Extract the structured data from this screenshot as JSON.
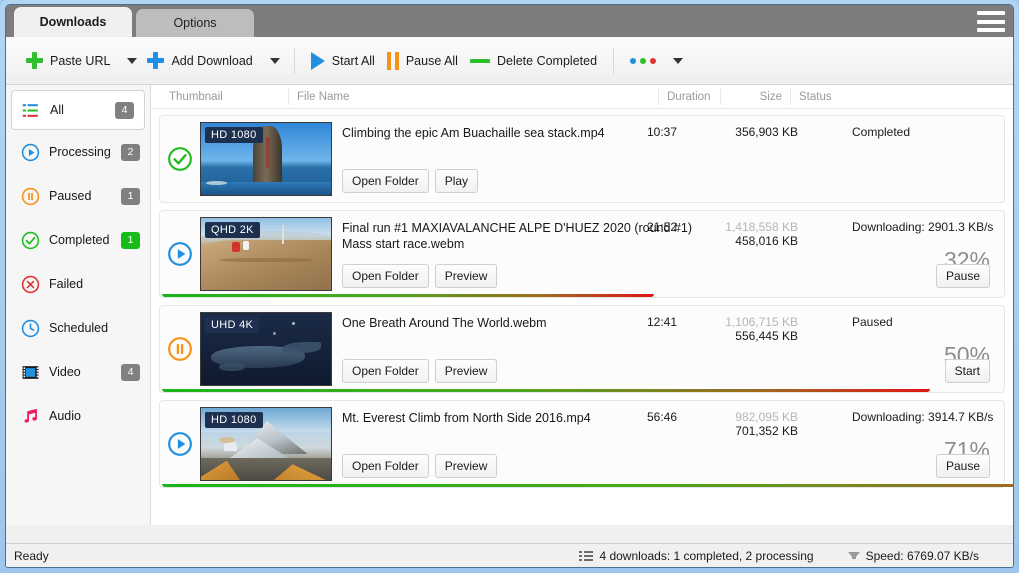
{
  "window": {
    "title": "Downloads"
  },
  "tabs": [
    {
      "label": "Downloads",
      "active": true
    },
    {
      "label": "Options",
      "active": false
    }
  ],
  "menu": {
    "hamburger_icon": "hamburger-icon"
  },
  "toolbar": {
    "paste_url": "Paste URL",
    "add_download": "Add Download",
    "start_all": "Start All",
    "pause_all": "Pause All",
    "delete_completed": "Delete Completed",
    "more_icon": "more-dots-icon"
  },
  "sidebar": {
    "items": [
      {
        "label": "All",
        "badge": "4",
        "badge_color": "#808080",
        "icon": "list-lines-icon",
        "selected": true
      },
      {
        "label": "Processing",
        "badge": "2",
        "badge_color": "#808080",
        "icon": "play-circle-icon",
        "selected": false
      },
      {
        "label": "Paused",
        "badge": "1",
        "badge_color": "#808080",
        "icon": "pause-circle-icon",
        "selected": false
      },
      {
        "label": "Completed",
        "badge": "1",
        "badge_color": "#18bb18",
        "icon": "check-circle-icon",
        "selected": false
      },
      {
        "label": "Failed",
        "badge": "",
        "badge_color": "",
        "icon": "error-circle-icon",
        "selected": false
      },
      {
        "label": "Scheduled",
        "badge": "",
        "badge_color": "",
        "icon": "clock-icon",
        "selected": false
      },
      {
        "label": "Video",
        "badge": "4",
        "badge_color": "#808080",
        "icon": "film-icon",
        "selected": false
      },
      {
        "label": "Audio",
        "badge": "",
        "badge_color": "",
        "icon": "music-note-icon",
        "selected": false
      }
    ]
  },
  "list": {
    "columns": [
      "Thumbnail",
      "File Name",
      "Duration",
      "Size",
      "Status"
    ],
    "rows": [
      {
        "state_icon": "check-circle-icon",
        "quality": "HD 1080",
        "filename": "Climbing the epic Am Buachaille sea stack.mp4",
        "duration": "10:37",
        "size_total": "356,903 KB",
        "size_done": "",
        "status": "Completed",
        "percent": "",
        "progress": 100,
        "buttons": [
          "Open Folder",
          "Play"
        ],
        "action_button": "",
        "show_progress_bar": false
      },
      {
        "state_icon": "play-circle-icon",
        "quality": "QHD 2K",
        "filename": "Final run #1  MAXIAVALANCHE ALPE D'HUEZ 2020 (round #1) Mass start race.webm",
        "duration": "21:52",
        "size_total": "1,418,558 KB",
        "size_done": "458,016 KB",
        "status": "Downloading: 2901.3 KB/s",
        "percent": "32%",
        "progress": 32,
        "buttons": [
          "Open Folder",
          "Preview"
        ],
        "action_button": "Pause",
        "show_progress_bar": true
      },
      {
        "state_icon": "pause-circle-icon",
        "quality": "UHD 4K",
        "filename": "One Breath Around The World.webm",
        "duration": "12:41",
        "size_total": "1,106,715 KB",
        "size_done": "556,445 KB",
        "status": "Paused",
        "percent": "50%",
        "progress": 50,
        "buttons": [
          "Open Folder",
          "Preview"
        ],
        "action_button": "Start",
        "show_progress_bar": true
      },
      {
        "state_icon": "play-circle-icon",
        "quality": "HD 1080",
        "filename": "Mt. Everest Climb from North Side 2016.mp4",
        "duration": "56:46",
        "size_total": "982,095 KB",
        "size_done": "701,352 KB",
        "status": "Downloading: 3914.7 KB/s",
        "percent": "71%",
        "progress": 71,
        "buttons": [
          "Open Folder",
          "Preview"
        ],
        "action_button": "Pause",
        "show_progress_bar": true
      }
    ]
  },
  "statusbar": {
    "ready": "Ready",
    "downloads_summary": "4 downloads: 1 completed, 2 processing",
    "speed": "Speed: 6769.07 KB/s"
  },
  "colors": {
    "accent_blue": "#1f8fe0",
    "green": "#27c127",
    "orange": "#f59218",
    "red": "#e03131",
    "badge_gray": "#808080"
  }
}
